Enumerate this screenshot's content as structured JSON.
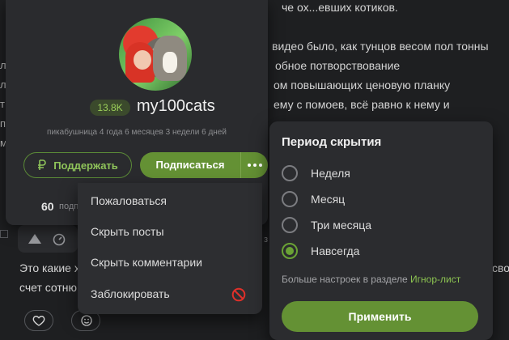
{
  "background": {
    "lines": [
      "че ох...евших котиков.",
      "видео было, как тунцов весом пол тонны",
      "обное потворствование",
      "ом повышающих ценовую планку",
      "ему с помоев, всё равно к нему и"
    ],
    "left_letters": [
      "л",
      "л",
      "т",
      "п",
      "м"
    ],
    "post_text_1": "Это какие х",
    "post_text_2": "счет сотню",
    "post_text_right": "сво",
    "post_gray": "з"
  },
  "profile": {
    "rating": "13.8K",
    "username": "my100cats",
    "meta": "пикабушница 4 года 6 месяцев 3 недели 6 дней",
    "support_label": "Поддержать",
    "subscribe_label": "Подписаться",
    "subscribers_count": "60",
    "subscribers_label": "подп"
  },
  "menu": {
    "items": [
      "Пожаловаться",
      "Скрыть посты",
      "Скрыть комментарии",
      "Заблокировать"
    ]
  },
  "period_panel": {
    "title": "Период скрытия",
    "options": [
      "Неделя",
      "Месяц",
      "Три месяца",
      "Навсегда"
    ],
    "selected": "Навсегда",
    "more_text": "Больше настроек в разделе ",
    "more_link": "Игнор-лист",
    "apply_label": "Применить"
  },
  "colors": {
    "accent": "#649134",
    "link": "#8cc351",
    "danger": "#e0302a"
  },
  "icons": [
    "ruble-icon",
    "more-dots-icon",
    "block-icon",
    "arrow-up-icon",
    "gauge-icon",
    "heart-icon",
    "smile-icon"
  ]
}
